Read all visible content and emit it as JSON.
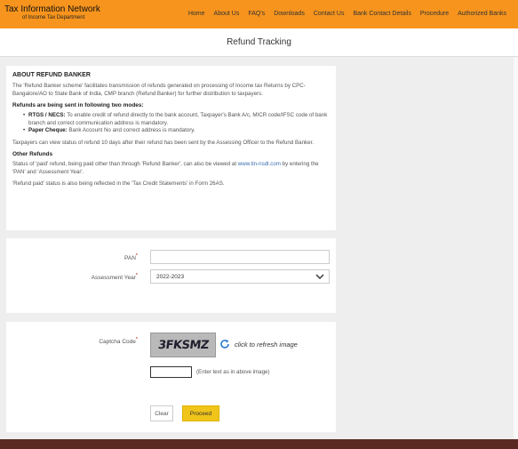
{
  "header": {
    "logo_line1": "Tax Information Network",
    "logo_line2": "of Income Tax Department",
    "nav": [
      "Home",
      "About Us",
      "FAQ's",
      "Downloads",
      "Contact Us",
      "Bank Contact Details",
      "Procedure",
      "Authorized Banks"
    ]
  },
  "page_title": "Refund Tracking",
  "about": {
    "heading": "ABOUT REFUND BANKER",
    "intro": "The 'Refund Banker scheme' facilitates transmission of refunds generated on processing of Income tax Returns by CPC-Bangalore/AO to State Bank of India, CMP branch (Refund Banker) for further distribution to taxpayers.",
    "modes_heading": "Refunds are being sent in following two modes:",
    "mode1_title": "RTGS / NECS:",
    "mode1_text": " To enable credit of refund directly to the bank account, Taxpayer's Bank A/c, MICR code/IFSC code of bank branch and correct communication address is mandatory.",
    "mode2_title": "Paper Cheque:",
    "mode2_text": " Bank Account No and correct address is mandatory.",
    "status_note": "Taxpayers can view status of refund 10 days after their refund has been sent by the Assessing Officer to the Refund Banker.",
    "other_heading": "Other Refunds",
    "other_text_a": "Status of 'paid' refund, being paid other than through 'Refund Banker', can also be viewed at ",
    "other_link": "www.tin-nsdl.com",
    "other_text_b": " by entering the 'PAN' and 'Assessment Year'.",
    "form26_note": "'Refund paid' status is also being reflected in the 'Tax Credit Statements' in Form 26AS."
  },
  "form": {
    "pan_label": "PAN",
    "pan_value": "",
    "ay_label": "Assessment Year",
    "ay_value": "2022-2023",
    "required_mark": "*",
    "captcha_label": "Captcha Code",
    "captcha_text": "3FKSMZ",
    "refresh_text": "click to refresh image",
    "captcha_hint": "(Enter text as in above image)",
    "clear_label": "Clear",
    "proceed_label": "Proceed"
  },
  "colors": {
    "header_bg": "#f7941d",
    "proceed_bg": "#f0c419",
    "footer_bg": "#5a2a22"
  },
  "icons": [
    "refresh-icon",
    "chevron-down-icon"
  ]
}
